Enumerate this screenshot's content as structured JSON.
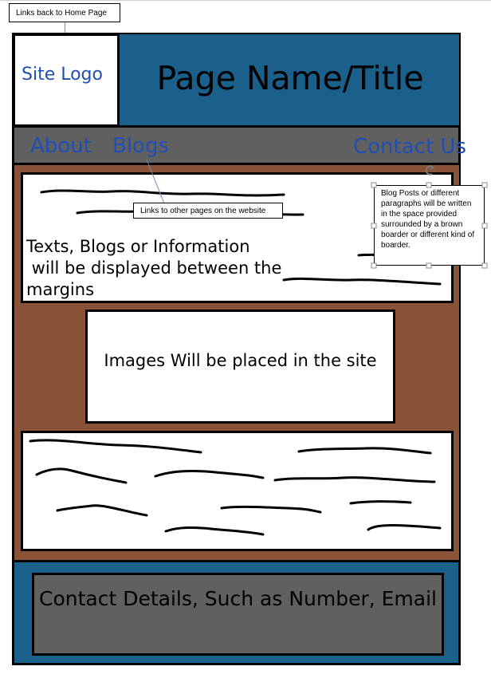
{
  "callouts": {
    "home_link": "Links back to Home Page",
    "nav_links": "Links to other pages on the website",
    "blog_note": "Blog Posts or different paragraphs will be written in the space provided surrounded by a brown boarder or different kind of boarder."
  },
  "header": {
    "logo": "Site Logo",
    "title": "Page Name/Title"
  },
  "nav": {
    "about": "About",
    "blogs": "Blogs",
    "contact": "Contact Us"
  },
  "content": {
    "text_line_1": "Texts, Blogs or Information",
    "text_line_2": " will be displayed between the",
    "text_line_3": "margins",
    "image_placeholder": "Images Will be placed in the site"
  },
  "footer": {
    "contact_details": "Contact Details, Such as Number, Email"
  },
  "colors": {
    "header_blue": "#1b5f8b",
    "nav_grey": "#606060",
    "content_brown": "#8a5236",
    "link_blue": "#1f4fb4"
  }
}
